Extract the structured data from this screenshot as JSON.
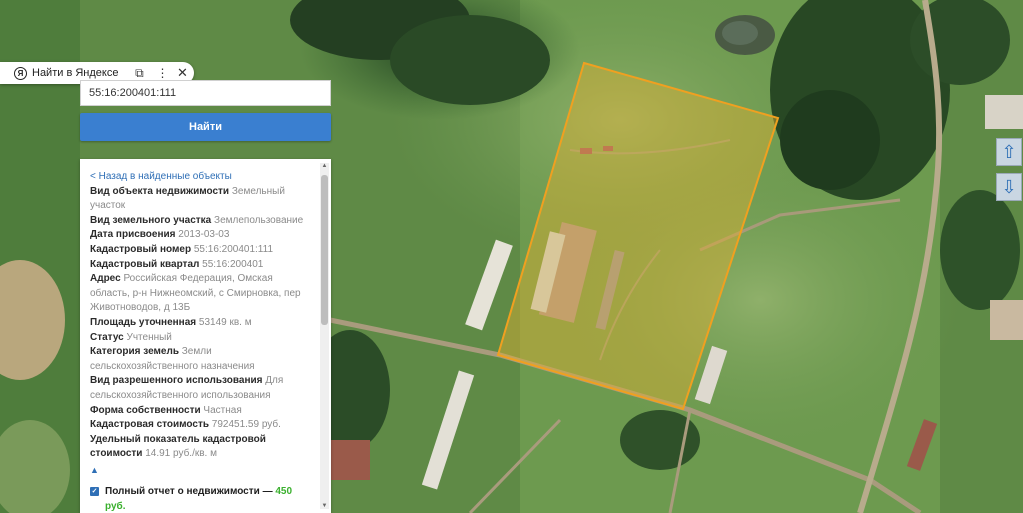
{
  "yandex_bar": {
    "label": "Найти в Яндексе",
    "logo_glyph": "Я",
    "copy_icon": "copy-icon",
    "more_icon": "more-vertical-icon",
    "close_icon": "close-icon"
  },
  "search": {
    "value": "55:16:200401:111",
    "button_label": "Найти"
  },
  "info": {
    "back_label": "< Назад в найденные объекты",
    "fields": [
      {
        "label": "Вид объекта недвижимости",
        "value": "Земельный участок"
      },
      {
        "label": "Вид земельного участка",
        "value": "Землепользование"
      },
      {
        "label": "Дата присвоения",
        "value": "2013-03-03"
      },
      {
        "label": "Кадастровый номер",
        "value": "55:16:200401:111"
      },
      {
        "label": "Кадастровый квартал",
        "value": "55:16:200401"
      },
      {
        "label": "Адрес",
        "value": "Российская Федерация, Омская область, р-н Нижнеомский, с Смирновка, пер Животноводов, д 13Б"
      },
      {
        "label": "Площадь уточненная",
        "value": "53149 кв. м"
      },
      {
        "label": "Статус",
        "value": "Учтенный"
      },
      {
        "label": "Категория земель",
        "value": "Земли сельскохозяйственного назначения"
      },
      {
        "label": "Вид разрешенного использования",
        "value": "Для сельскохозяйственного использования"
      },
      {
        "label": "Форма собственности",
        "value": "Частная"
      },
      {
        "label": "Кадастровая стоимость",
        "value": "792451.59 руб."
      },
      {
        "label": "Удельный показатель кадастровой стоимости",
        "value": "14.91 руб./кв. м"
      }
    ],
    "collapse_glyph": "▲",
    "report_label": "Полный отчет о недвижимости —",
    "report_price": "450 руб."
  },
  "map": {
    "parcel_color": "#f0a020",
    "parcel_fill": "#e0b030",
    "nav_up_icon": "arrow-up-icon",
    "nav_down_icon": "arrow-down-icon"
  }
}
